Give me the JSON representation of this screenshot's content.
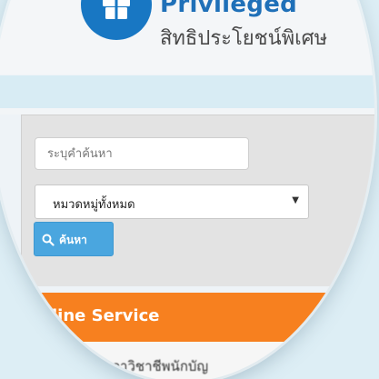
{
  "brand": {
    "title": "Privileged",
    "subtitle": "สิทธิประโยชน์พิเศษ",
    "primary_color": "#1f70b8",
    "logo_icon": "gift-icon"
  },
  "search": {
    "placeholder": "ระบุคำค้นหา",
    "category_value": "หมวดหมู่ทั้งหมด",
    "button_label": "ค้นหา",
    "button_color": "#4aa6df"
  },
  "online_service": {
    "label": "line Service",
    "color": "#f7801f",
    "first_item": "สภาวิชาชีพนักบัญ"
  }
}
